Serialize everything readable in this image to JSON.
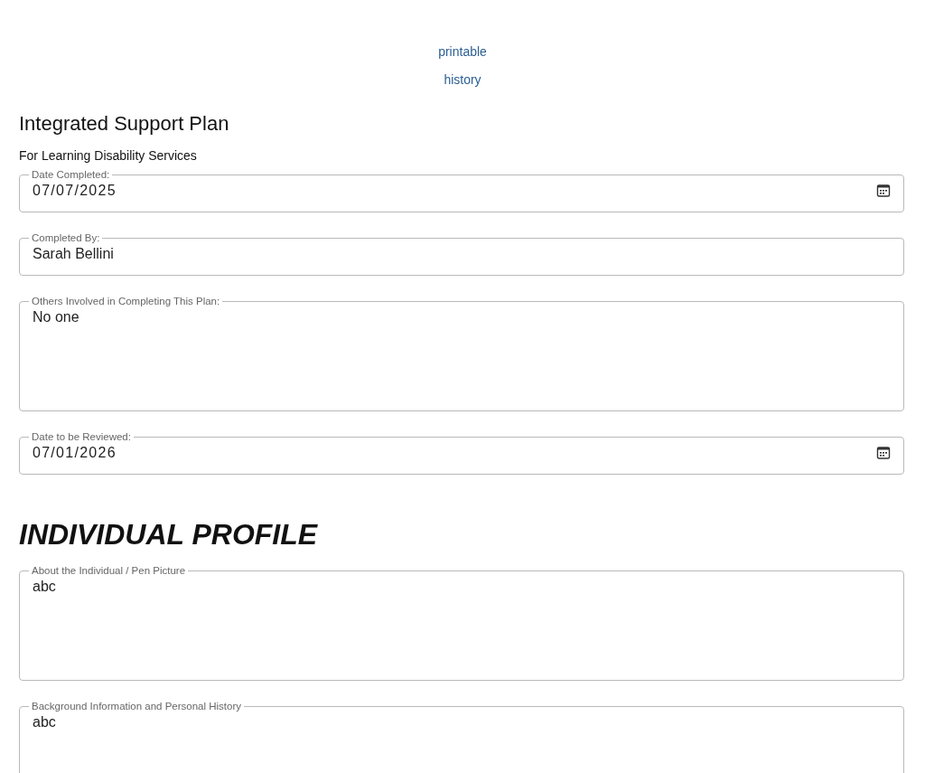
{
  "links": [
    "printable",
    "history"
  ],
  "title": "Integrated Support Plan",
  "subtitle": "For Learning Disability Services",
  "plan_fields": [
    {
      "kind": "date",
      "label": "Date Completed:",
      "value": "07/07/2025"
    },
    {
      "kind": "text",
      "label": "Completed By:",
      "value": "Sarah Bellini"
    },
    {
      "kind": "textarea",
      "label": "Others Involved in Completing This Plan:",
      "value": "No one"
    },
    {
      "kind": "date",
      "label": "Date to be Reviewed:",
      "value": "07/01/2026"
    }
  ],
  "section_heading": "INDIVIDUAL PROFILE",
  "profile_fields": [
    {
      "kind": "textarea",
      "label": "About the Individual / Pen Picture",
      "value": "abc"
    },
    {
      "kind": "textarea",
      "label": "Background Information and Personal History",
      "value": "abc"
    }
  ]
}
